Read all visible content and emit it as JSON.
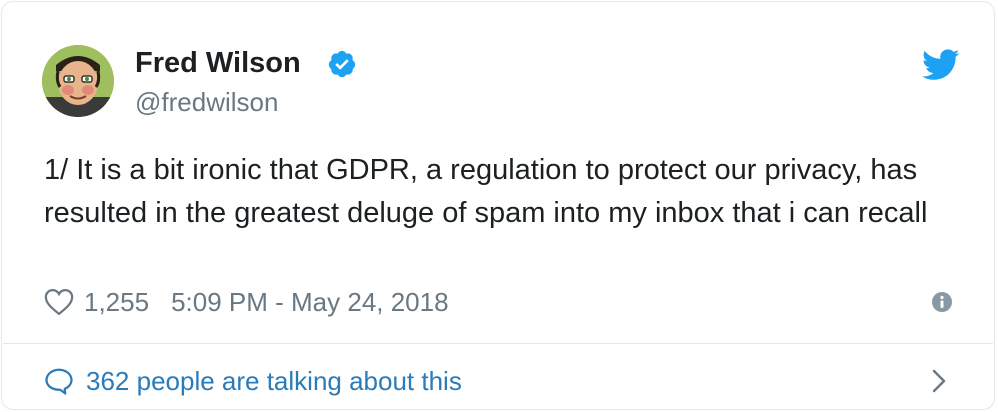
{
  "author": {
    "name": "Fred Wilson",
    "handle": "@fredwilson",
    "avatar_icon": "avatar-portrait",
    "verified_icon": "verified-badge-icon"
  },
  "brand": {
    "icon": "twitter-bird-icon",
    "color": "#1da1f2"
  },
  "tweet": {
    "text": "1/ It is a bit ironic that GDPR, a regulation to protect our privacy, has resulted in the greatest deluge of spam into my inbox that i can recall"
  },
  "meta": {
    "like_icon": "heart-icon",
    "likes": "1,255",
    "timestamp": "5:09 PM - May 24, 2018",
    "info_icon": "info-icon"
  },
  "conversation": {
    "icon": "speech-bubble-icon",
    "label": "362 people are talking about this",
    "chevron_icon": "chevron-right-icon",
    "link_color": "#2b7bb9"
  }
}
